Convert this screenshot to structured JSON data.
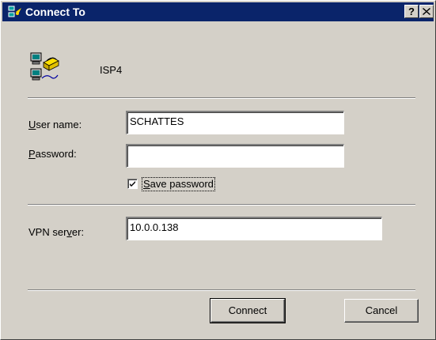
{
  "window": {
    "title": "Connect To",
    "help_label": "?",
    "close_label": "✕"
  },
  "connection": {
    "name": "ISP4",
    "icon": "dialup-connection-icon"
  },
  "form": {
    "username": {
      "label_access": "U",
      "label_rest": "ser name:",
      "value": "SCHATTES"
    },
    "password": {
      "label_access": "P",
      "label_rest": "assword:",
      "value": ""
    },
    "save_password": {
      "label_access": "S",
      "label_rest": "ave password",
      "checked": true
    },
    "vpn_server": {
      "label_pre": "VPN ser",
      "label_access": "v",
      "label_post": "er:",
      "value": "10.0.0.138"
    }
  },
  "buttons": {
    "connect_label": "Connect",
    "cancel_label": "Cancel"
  },
  "colors": {
    "titlebar": "#0a246a",
    "face": "#d4d0c8"
  }
}
